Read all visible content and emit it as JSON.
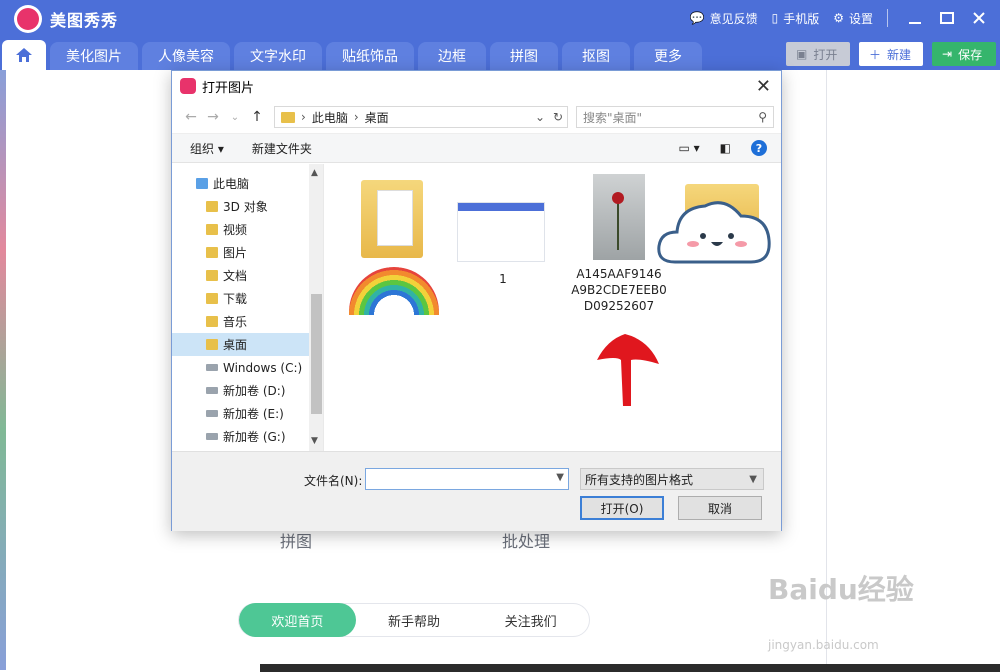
{
  "app": {
    "title": "美图秀秀",
    "top_links": [
      "意见反馈",
      "手机版",
      "设置"
    ]
  },
  "tabs": [
    "美化图片",
    "人像美容",
    "文字水印",
    "贴纸饰品",
    "边框",
    "拼图",
    "抠图",
    "更多"
  ],
  "actions": {
    "open": "打开",
    "new": "新建",
    "save": "保存"
  },
  "background": {
    "labels": [
      "拼图",
      "批处理"
    ],
    "bottom_nav": [
      "欢迎首页",
      "新手帮助",
      "关注我们"
    ],
    "watermark": "Baidu经验",
    "watermark_url": "jingyan.baidu.com"
  },
  "dialog": {
    "title": "打开图片",
    "address": {
      "root": "此电脑",
      "current": "桌面"
    },
    "search_placeholder": "搜索\"桌面\"",
    "toolbar": {
      "organize": "组织 ▾",
      "new_folder": "新建文件夹"
    },
    "tree": [
      {
        "label": "此电脑",
        "type": "pc"
      },
      {
        "label": "3D 对象",
        "type": "folder"
      },
      {
        "label": "视频",
        "type": "folder"
      },
      {
        "label": "图片",
        "type": "folder"
      },
      {
        "label": "文档",
        "type": "folder"
      },
      {
        "label": "下载",
        "type": "folder"
      },
      {
        "label": "音乐",
        "type": "folder"
      },
      {
        "label": "桌面",
        "type": "folder",
        "selected": true
      },
      {
        "label": "Windows (C:)",
        "type": "drive"
      },
      {
        "label": "新加卷 (D:)",
        "type": "drive"
      },
      {
        "label": "新加卷 (E:)",
        "type": "drive"
      },
      {
        "label": "新加卷 (G:)",
        "type": "drive"
      }
    ],
    "files": [
      {
        "name": "",
        "kind": "folder"
      },
      {
        "name": "1",
        "kind": "screenshot"
      },
      {
        "name": "A145AAF9146\nA9B2CDE7EEB0\nD09252607",
        "kind": "image"
      },
      {
        "name": "",
        "kind": "folder"
      }
    ],
    "filename_label": "文件名(N):",
    "filename_value": "",
    "filter": "所有支持的图片格式",
    "buttons": {
      "open": "打开(O)",
      "cancel": "取消"
    }
  },
  "colors": {
    "brand": "#4c6fd8",
    "save": "#35b56c",
    "active_nav": "#4ec795"
  }
}
